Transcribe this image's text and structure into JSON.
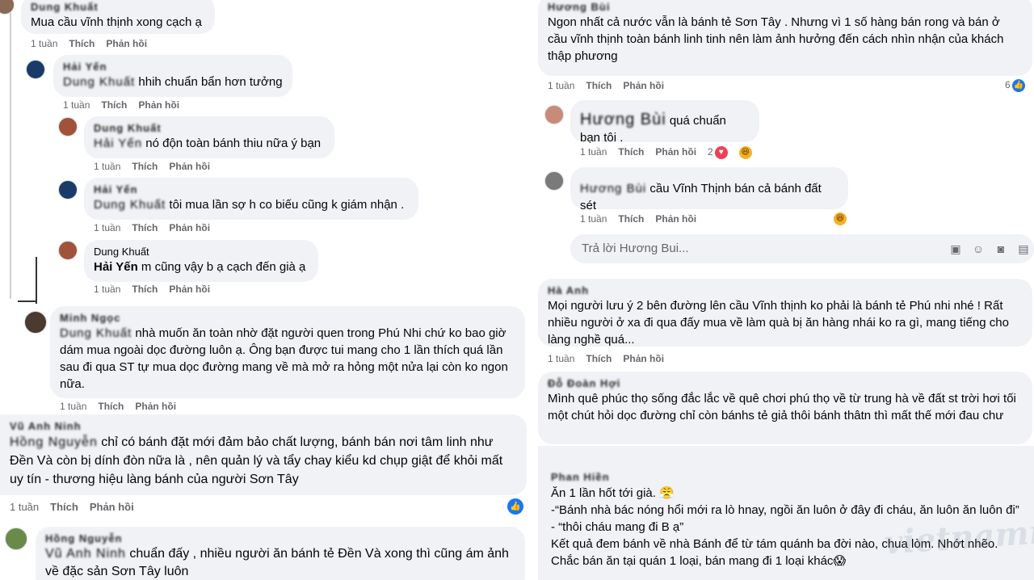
{
  "left": {
    "c0": {
      "author": "Dung Khuất",
      "text": "Mua cầu vĩnh thịnh xong cạch ạ",
      "time": "1 tuần",
      "like": "Thích",
      "reply": "Phản hồi"
    },
    "c1": {
      "author": "Hải Yến",
      "tag": "Dung Khuất",
      "text": " hhih chuẩn bẩn hơn tưởng",
      "time": "1 tuần",
      "like": "Thích",
      "reply": "Phản hồi"
    },
    "c2": {
      "author": "Dung Khuất",
      "tag": "Hải Yến",
      "text": " nó độn toàn bánh thiu nữa ý bạn",
      "time": "1 tuần",
      "like": "Thích",
      "reply": "Phản hồi"
    },
    "c3": {
      "author": "Hải Yến",
      "tag": "Dung Khuất",
      "text": " tôi mua lần sợ h co biếu cũng k giám nhận .",
      "time": "1 tuần",
      "like": "Thích",
      "reply": "Phản hồi"
    },
    "c4": {
      "author": "Dung Khuất",
      "tag": "Hải Yến",
      "text": " m cũng vậy b ạ cạch đến già ạ",
      "time": "1 tuần",
      "like": "Thích",
      "reply": "Phản hồi"
    },
    "c5": {
      "author": "Minh Ngọc",
      "tag": "Dung Khuất",
      "text": " nhà muốn ăn toàn nhờ đặt người quen trong Phú Nhi chứ ko bao giờ dám mua ngoài dọc đường luôn ạ. Ông bạn được tui mang cho 1 lần thích quá lần sau đi qua ST tự mua dọc đường mang về mà mở ra hỏng một nửa lại còn ko ngon nữa.",
      "time": "1 tuần",
      "like": "Thích",
      "reply": "Phản hồi"
    },
    "c6": {
      "author": "Vũ Anh Ninh",
      "tag": "Hồng Nguyễn",
      "text": " chỉ có bánh đặt mới đảm bảo chất lượng, bánh bán nơi tâm linh như Đền Và còn bị dính đòn nữa là , nên quản lý và tẩy chay kiểu kd chụp giật để khỏi mất uy tín - thương hiệu làng bánh của người Sơn Tây",
      "time": "1 tuần",
      "like": "Thích",
      "reply": "Phản hồi",
      "like_icon": "👍"
    },
    "c7": {
      "author": "Hồng Nguyễn",
      "tag": "Vũ Anh Ninh",
      "text": " chuẩn đấy , nhiều người ăn bánh tẻ Đền Và xong thì cũng ám ảnh về đặc sản Sơn Tây luôn"
    }
  },
  "right": {
    "r0": {
      "author": "Hương Bùi",
      "text": "Ngon nhất cả nước vẫn là bánh tẻ Sơn Tây . Nhưng vì 1 số hàng bán rong và bán ở cầu vĩnh thịnh toàn bánh linh tinh nên làm ảnh hưởng đến cách nhìn nhận của khách thập phương",
      "time": "1 tuần",
      "like": "Thích",
      "reply": "Phản hồi",
      "reactions": "6"
    },
    "r1": {
      "tag": "Hương Bùi",
      "text": " quá chuẩn bạn tôi .",
      "time": "1 tuần",
      "like": "Thích",
      "reply": "Phản hồi",
      "reactions": "2"
    },
    "r2": {
      "tag": "Hương Bùi",
      "text": " cầu Vĩnh Thịnh bán cả bánh đất sét",
      "time": "1 tuần",
      "like": "Thích",
      "reply": "Phản hồi"
    },
    "reply_placeholder": "Trả lời Hương Bui...",
    "r3": {
      "author": "Hà Anh",
      "text": "Mọi người lưu ý 2 bên đường lên cầu Vĩnh thịnh ko phải là bánh tẻ Phú nhi nhé ! Rất nhiều người ở xa đi qua đấy mua về làm quà bị ăn hàng nhái ko ra gì, mang tiếng cho làng nghề quá...",
      "time": "1 tuần",
      "like": "Thích",
      "reply": "Phản hồi"
    },
    "r4": {
      "author": "Đỗ Đoàn Hợi",
      "text": "Mình quê phúc thọ sống đắc lắc về quê chơi phú thọ về từ trung hà về đất st trời hơi tối một chút hỏi dọc đường chỉ còn bánhs tẻ giả thôi bánh thâtn thì mất thế mới đau chư"
    },
    "r5": {
      "author": "Phan Hiền",
      "lines": [
        "Ăn 1 lần hốt tới già. 😤",
        "-“Bánh nhà bác nóng hổi mới ra lò hnay, ngồi ăn luôn ở đây đi cháu, ăn luôn ăn luôn đi”",
        "- “thôi cháu mang đi B ạ”",
        "Kết quả đem bánh về nhà Bánh để từ tám quánh ba đời nào, chua lòm. Nhớt nhẽo.",
        "Chắc bán ăn tại quán 1 loại, bán mang đi 1 loại khác😱"
      ]
    },
    "watermark": "vietnamnet"
  }
}
